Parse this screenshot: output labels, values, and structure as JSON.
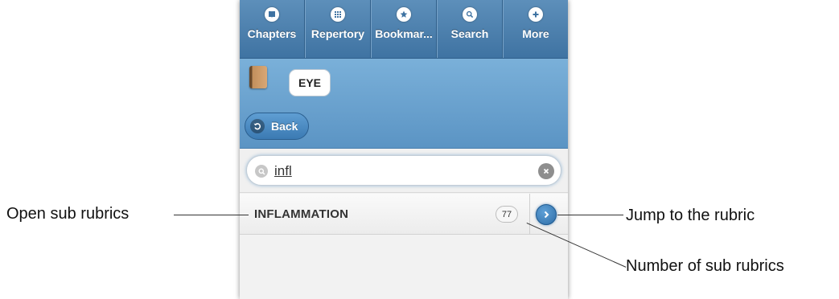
{
  "navbar": {
    "items": [
      {
        "label": "Chapters",
        "icon": "book-icon"
      },
      {
        "label": "Repertory",
        "icon": "grid-icon"
      },
      {
        "label": "Bookmar...",
        "icon": "star-icon"
      },
      {
        "label": "Search",
        "icon": "search-icon"
      },
      {
        "label": "More",
        "icon": "plus-icon"
      }
    ]
  },
  "header": {
    "chapter": "EYE",
    "back_label": "Back"
  },
  "search": {
    "value": "infl"
  },
  "results": [
    {
      "label": "INFLAMMATION",
      "count": "77"
    }
  ],
  "callouts": {
    "open_sub": "Open sub rubrics",
    "jump": "Jump to the rubric",
    "count": "Number of sub rubrics"
  },
  "colors": {
    "accent": "#4f86b6",
    "header": "#6aa2cf"
  }
}
